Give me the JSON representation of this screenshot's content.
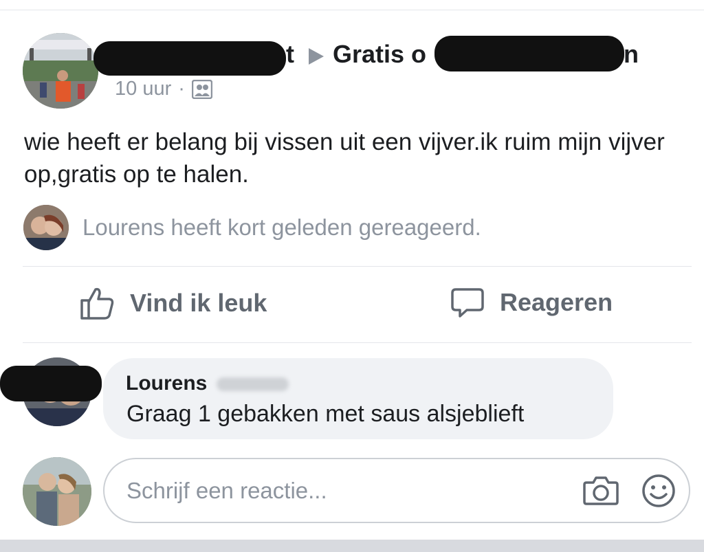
{
  "post": {
    "author_visible_tail": "t",
    "group_prefix": "Gratis o",
    "group_suffix": "n",
    "timestamp": "10 uur",
    "separator": "·",
    "audience_icon": "group-icon",
    "text": "wie heeft er belang bij vissen uit een vijver.ik ruim mijn vijver op,gratis op te halen."
  },
  "activity": {
    "text": "Lourens heeft kort geleden gereageerd."
  },
  "actions": {
    "like_label": "Vind ik leuk",
    "comment_label": "Reageren"
  },
  "comment": {
    "author": "Lourens",
    "text": "Graag 1 gebakken met saus alsjeblieft"
  },
  "composer": {
    "placeholder": "Schrijf een reactie...",
    "camera_icon": "camera-icon",
    "emoji_icon": "smiley-icon"
  },
  "colors": {
    "secondary_text": "#8d949e",
    "action_text": "#606770",
    "bubble_bg": "#f0f2f5",
    "divider": "#e4e6ea"
  }
}
